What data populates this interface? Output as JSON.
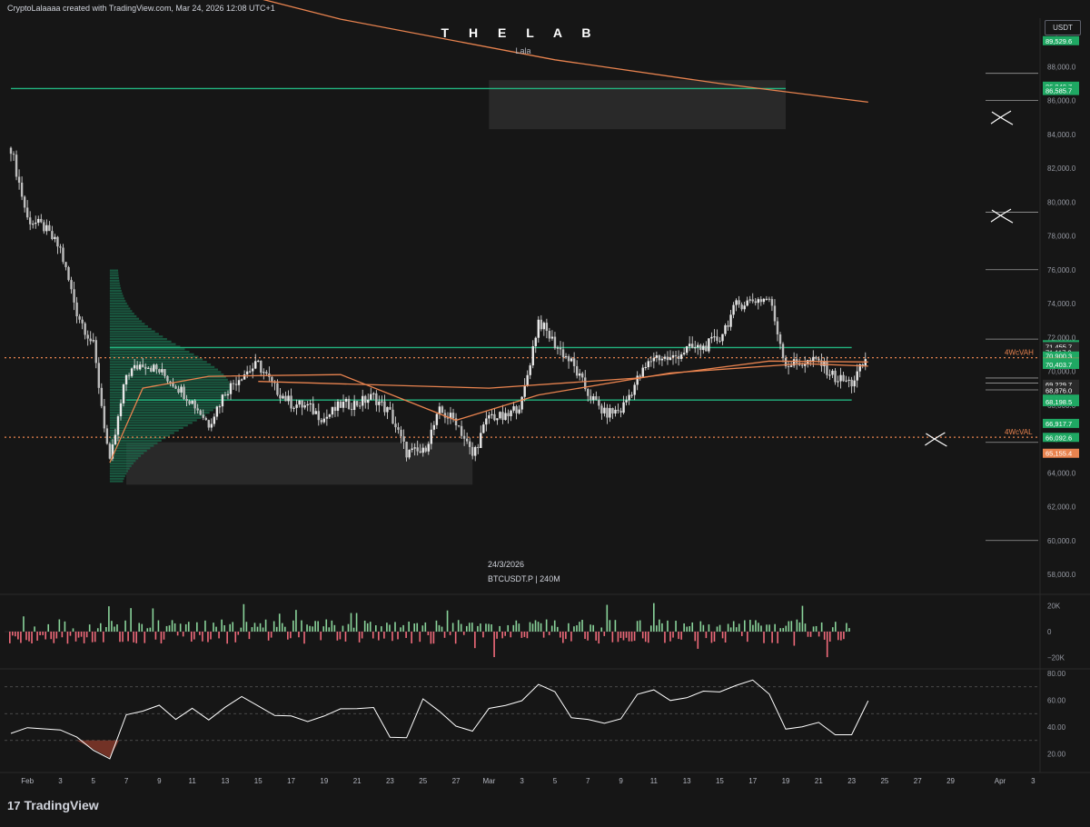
{
  "header": {
    "credit": "CryptoLalaaaa created with TradingView.com, Mar 24, 2026 12:08 UTC+1",
    "title": "T H E  L A B",
    "subtitle": "Lala",
    "currency": "USDT",
    "date_note": "24/3/2026",
    "symbol_note": "BTCUSDT.P | 240M"
  },
  "footer": {
    "logo_glyph": "17",
    "brand": "TradingView"
  },
  "colors": {
    "background": "#161616",
    "grid": "#232323",
    "candle": "#e8e8e8",
    "green_line": "#22b37f",
    "green_label": "#1fa863",
    "orange": "#e8834f",
    "volume_up": "#89d39a",
    "volume_down": "#ef6a7a",
    "rsi_line": "#ffffff",
    "rsi_oversold_fill": "#8a3a2a"
  },
  "chart_data": [
    {
      "type": "candlestick",
      "name": "BTCUSDT.P",
      "timeframe": "240M",
      "x_axis_labels": [
        "Feb",
        "3",
        "5",
        "7",
        "9",
        "11",
        "13",
        "15",
        "17",
        "19",
        "21",
        "23",
        "25",
        "27",
        "Mar",
        "3",
        "5",
        "7",
        "9",
        "11",
        "13",
        "15",
        "17",
        "19",
        "21",
        "23",
        "25",
        "27",
        "29",
        "Apr",
        "3",
        "5"
      ],
      "y_axis_ticks": [
        58000,
        60000,
        62000,
        64000,
        66000,
        68000,
        70000,
        72000,
        74000,
        76000,
        78000,
        80000,
        82000,
        84000,
        86000,
        88000,
        90000
      ],
      "y_axis_tick_labels": [
        "58,000.0",
        "60,000.0",
        "62,000.0",
        "64,000.0",
        "66,000.0",
        "68,000.0",
        "70,000.0",
        "72,000.0",
        "74,000.0",
        "76,000.0",
        "78,000.0",
        "80,000.0",
        "82,000.0",
        "84,000.0",
        "86,000.0",
        "88,000.0",
        "90,000.0"
      ],
      "ylim": [
        56500,
        91500
      ],
      "price_path": [
        {
          "date": "2026-01-31",
          "price": 83200
        },
        {
          "date": "2026-02-01",
          "price": 79000
        },
        {
          "date": "2026-02-02",
          "price": 78500
        },
        {
          "date": "2026-02-03",
          "price": 77200
        },
        {
          "date": "2026-02-04",
          "price": 73500
        },
        {
          "date": "2026-02-05",
          "price": 71500
        },
        {
          "date": "2026-02-06",
          "price": 64500
        },
        {
          "date": "2026-02-07",
          "price": 69800
        },
        {
          "date": "2026-02-08",
          "price": 70500
        },
        {
          "date": "2026-02-09",
          "price": 70000
        },
        {
          "date": "2026-02-10",
          "price": 69200
        },
        {
          "date": "2026-02-11",
          "price": 68200
        },
        {
          "date": "2026-02-12",
          "price": 66900
        },
        {
          "date": "2026-02-13",
          "price": 68800
        },
        {
          "date": "2026-02-14",
          "price": 69800
        },
        {
          "date": "2026-02-15",
          "price": 70400
        },
        {
          "date": "2026-02-16",
          "price": 69000
        },
        {
          "date": "2026-02-17",
          "price": 68100
        },
        {
          "date": "2026-02-18",
          "price": 67900
        },
        {
          "date": "2026-02-19",
          "price": 67200
        },
        {
          "date": "2026-02-20",
          "price": 68000
        },
        {
          "date": "2026-02-21",
          "price": 68100
        },
        {
          "date": "2026-02-22",
          "price": 68500
        },
        {
          "date": "2026-02-23",
          "price": 67500
        },
        {
          "date": "2026-02-24",
          "price": 65200
        },
        {
          "date": "2026-02-25",
          "price": 65200
        },
        {
          "date": "2026-02-26",
          "price": 67600
        },
        {
          "date": "2026-02-27",
          "price": 67100
        },
        {
          "date": "2026-02-28",
          "price": 65000
        },
        {
          "date": "2026-03-01",
          "price": 67400
        },
        {
          "date": "2026-03-02",
          "price": 67200
        },
        {
          "date": "2026-03-03",
          "price": 68200
        },
        {
          "date": "2026-03-04",
          "price": 73000
        },
        {
          "date": "2026-03-05",
          "price": 71600
        },
        {
          "date": "2026-03-06",
          "price": 70500
        },
        {
          "date": "2026-03-07",
          "price": 68700
        },
        {
          "date": "2026-03-08",
          "price": 67500
        },
        {
          "date": "2026-03-09",
          "price": 67700
        },
        {
          "date": "2026-03-10",
          "price": 69500
        },
        {
          "date": "2026-03-11",
          "price": 70900
        },
        {
          "date": "2026-03-12",
          "price": 70700
        },
        {
          "date": "2026-03-13",
          "price": 71300
        },
        {
          "date": "2026-03-14",
          "price": 71400
        },
        {
          "date": "2026-03-15",
          "price": 72000
        },
        {
          "date": "2026-03-16",
          "price": 73900
        },
        {
          "date": "2026-03-17",
          "price": 74200
        },
        {
          "date": "2026-03-18",
          "price": 74300
        },
        {
          "date": "2026-03-19",
          "price": 70400
        },
        {
          "date": "2026-03-20",
          "price": 70500
        },
        {
          "date": "2026-03-21",
          "price": 70600
        },
        {
          "date": "2026-03-22",
          "price": 69600
        },
        {
          "date": "2026-03-23",
          "price": 69300
        },
        {
          "date": "2026-03-24",
          "price": 70900
        }
      ],
      "overlay_lines": [
        {
          "name": "long-term moving average",
          "color": "#e8834f",
          "points": [
            {
              "date": "2026-02-01",
              "price": 95500
            },
            {
              "date": "2026-02-20",
              "price": 90800
            },
            {
              "date": "2026-03-05",
              "price": 88400
            },
            {
              "date": "2026-03-15",
              "price": 87000
            },
            {
              "date": "2026-03-24",
              "price": 85900
            }
          ]
        },
        {
          "name": "mid-term moving average",
          "color": "#e8834f",
          "points": [
            {
              "date": "2026-02-15",
              "price": 69400
            },
            {
              "date": "2026-03-01",
              "price": 69000
            },
            {
              "date": "2026-03-10",
              "price": 69600
            },
            {
              "date": "2026-03-18",
              "price": 70600
            },
            {
              "date": "2026-03-24",
              "price": 70550
            }
          ]
        },
        {
          "name": "short-term moving average",
          "color": "#e8834f",
          "points": [
            {
              "date": "2026-02-06",
              "price": 64600
            },
            {
              "date": "2026-02-08",
              "price": 69000
            },
            {
              "date": "2026-02-12",
              "price": 69700
            },
            {
              "date": "2026-02-20",
              "price": 69800
            },
            {
              "date": "2026-02-27",
              "price": 67100
            },
            {
              "date": "2026-03-04",
              "price": 68600
            },
            {
              "date": "2026-03-12",
              "price": 69900
            },
            {
              "date": "2026-03-20",
              "price": 70450
            },
            {
              "date": "2026-03-24",
              "price": 70300
            }
          ]
        }
      ],
      "horizontal_levels": [
        {
          "price": 86700,
          "color": "#22b37f",
          "from": "2026-01-31",
          "to": "2026-03-19"
        },
        {
          "price": 71400,
          "color": "#22b37f",
          "from": "2026-02-06",
          "to": "2026-03-23"
        },
        {
          "price": 68300,
          "color": "#22b37f",
          "from": "2026-02-07",
          "to": "2026-03-23"
        },
        {
          "price": 70800,
          "color": "#e8834f",
          "style": "dotted",
          "label": "4WcVAH"
        },
        {
          "price": 66100,
          "color": "#e8834f",
          "style": "dotted",
          "label": "4WcVAL"
        }
      ],
      "zones": [
        {
          "from": "2026-03-01",
          "to": "2026-03-19",
          "price_low": 84300,
          "price_high": 87200
        },
        {
          "from": "2026-02-07",
          "to": "2026-02-28",
          "price_low": 63300,
          "price_high": 65800
        }
      ],
      "volume_profile": {
        "anchor": "2026-02-06",
        "peak_price": 69000,
        "price_low": 63500,
        "price_high": 76000
      },
      "price_labels": [
        {
          "text": "89,529.6",
          "price": 89530,
          "bg": "#1fa863"
        },
        {
          "text": "86,840.7",
          "price": 86841,
          "bg": "#1fa863"
        },
        {
          "text": "86,585.7",
          "price": 86586,
          "bg": "#1fa863"
        },
        {
          "text": "71,568.6",
          "price": 71568,
          "bg": "#1fa863"
        },
        {
          "text": "71,455.7",
          "price": 71456,
          "bg": "#2a2a2a"
        },
        {
          "text": "71,117.9",
          "price": 71118,
          "bg": "#2a2a2a"
        },
        {
          "text": "51:53",
          "price": 70779,
          "bg": "#2a2a2a"
        },
        {
          "text": "70,900.3",
          "price": 70900,
          "bg": "#1fa863"
        },
        {
          "text": "70,526.1",
          "price": 70526,
          "bg": "#e8834f"
        },
        {
          "text": "70,502.6",
          "price": 70503,
          "bg": "#1fa863"
        },
        {
          "text": "70,403.7",
          "price": 70404,
          "bg": "#1fa863"
        },
        {
          "text": "69,229.7",
          "price": 69230,
          "bg": "#2a2a2a"
        },
        {
          "text": "68,876.0",
          "price": 68876,
          "bg": "#2a2a2a"
        },
        {
          "text": "68,349.6",
          "price": 68350,
          "bg": "#1fa863"
        },
        {
          "text": "68,198.5",
          "price": 68199,
          "bg": "#1fa863"
        },
        {
          "text": "66,917.7",
          "price": 66918,
          "bg": "#1fa863"
        },
        {
          "text": "66,092.6",
          "price": 66093,
          "bg": "#1fa863"
        },
        {
          "text": "65,155.4",
          "price": 65155,
          "bg": "#e8834f"
        }
      ],
      "right_side_levels": [
        87600,
        86000,
        79400,
        76000,
        71900,
        69600,
        69300,
        68900,
        65800,
        60000
      ],
      "drawing_marks": [
        {
          "date": "2026-04-01",
          "price": 85000,
          "kind": "cross"
        },
        {
          "date": "2026-04-01",
          "price": 79200,
          "kind": "cross"
        },
        {
          "date": "2026-03-28",
          "price": 66000,
          "kind": "cross"
        }
      ]
    },
    {
      "type": "bar",
      "name": "volume delta",
      "y_axis_ticks": [
        20000,
        0,
        -20000
      ],
      "y_axis_tick_labels": [
        "20K",
        "0",
        "−20K"
      ],
      "ylim": [
        -27000,
        27000
      ],
      "x_axis_labels_shared": true
    },
    {
      "type": "line",
      "name": "RSI",
      "y_axis_ticks": [
        20,
        40,
        60,
        80
      ],
      "y_axis_tick_labels": [
        "20.00",
        "40.00",
        "60.00",
        "80.00"
      ],
      "ylim": [
        10,
        85
      ],
      "reference_levels": [
        30,
        50,
        70
      ],
      "series": [
        {
          "date": "2026-01-31",
          "value": 35
        },
        {
          "date": "2026-02-01",
          "value": 40
        },
        {
          "date": "2026-02-03",
          "value": 38
        },
        {
          "date": "2026-02-04",
          "value": 32
        },
        {
          "date": "2026-02-05",
          "value": 24
        },
        {
          "date": "2026-02-06",
          "value": 17
        },
        {
          "date": "2026-02-07",
          "value": 49
        },
        {
          "date": "2026-02-08",
          "value": 50
        },
        {
          "date": "2026-02-09",
          "value": 55
        },
        {
          "date": "2026-02-10",
          "value": 47
        },
        {
          "date": "2026-02-11",
          "value": 52
        },
        {
          "date": "2026-02-12",
          "value": 44
        },
        {
          "date": "2026-02-13",
          "value": 55
        },
        {
          "date": "2026-02-14",
          "value": 61
        },
        {
          "date": "2026-02-15",
          "value": 56
        },
        {
          "date": "2026-02-16",
          "value": 48
        },
        {
          "date": "2026-02-17",
          "value": 49
        },
        {
          "date": "2026-02-18",
          "value": 43
        },
        {
          "date": "2026-02-19",
          "value": 48
        },
        {
          "date": "2026-02-20",
          "value": 53
        },
        {
          "date": "2026-02-21",
          "value": 54
        },
        {
          "date": "2026-02-22",
          "value": 56
        },
        {
          "date": "2026-02-23",
          "value": 33
        },
        {
          "date": "2026-02-24",
          "value": 32
        },
        {
          "date": "2026-02-25",
          "value": 63
        },
        {
          "date": "2026-02-26",
          "value": 53
        },
        {
          "date": "2026-02-27",
          "value": 41
        },
        {
          "date": "2026-02-28",
          "value": 35
        },
        {
          "date": "2026-03-01",
          "value": 53
        },
        {
          "date": "2026-03-02",
          "value": 57
        },
        {
          "date": "2026-03-03",
          "value": 60
        },
        {
          "date": "2026-03-04",
          "value": 73
        },
        {
          "date": "2026-03-05",
          "value": 66
        },
        {
          "date": "2026-03-06",
          "value": 45
        },
        {
          "date": "2026-03-07",
          "value": 44
        },
        {
          "date": "2026-03-08",
          "value": 43
        },
        {
          "date": "2026-03-09",
          "value": 45
        },
        {
          "date": "2026-03-10",
          "value": 64
        },
        {
          "date": "2026-03-11",
          "value": 66
        },
        {
          "date": "2026-03-12",
          "value": 60
        },
        {
          "date": "2026-03-13",
          "value": 63
        },
        {
          "date": "2026-03-14",
          "value": 66
        },
        {
          "date": "2026-03-15",
          "value": 65
        },
        {
          "date": "2026-03-16",
          "value": 72
        },
        {
          "date": "2026-03-17",
          "value": 75
        },
        {
          "date": "2026-03-18",
          "value": 66
        },
        {
          "date": "2026-03-19",
          "value": 40
        },
        {
          "date": "2026-03-20",
          "value": 41
        },
        {
          "date": "2026-03-21",
          "value": 45
        },
        {
          "date": "2026-03-22",
          "value": 33
        },
        {
          "date": "2026-03-23",
          "value": 34
        },
        {
          "date": "2026-03-24",
          "value": 60
        }
      ]
    }
  ]
}
